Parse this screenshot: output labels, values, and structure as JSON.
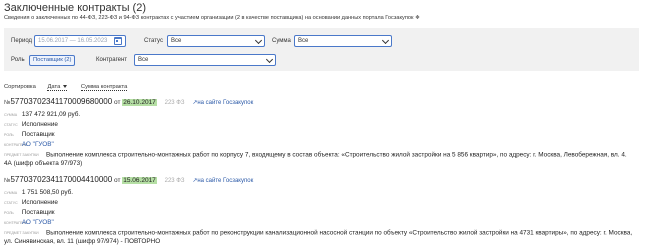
{
  "page": {
    "title": "Заключенные контракты (2)",
    "subtitle": "Сведения о заключенных по 44-ФЗ, 223-ФЗ и 94-ФЗ контрактах с участием организации (2 в качестве поставщика) на основании данных портала Госзакупок",
    "info_icon": "info-icon"
  },
  "filters": {
    "period_label": "Период",
    "period_placeholder": "15.06.2017 — 16.05.2023",
    "status_label": "Статус",
    "status_value": "Все",
    "sum_label": "Сумма",
    "sum_value": "Все",
    "role_label": "Роль",
    "role_value": "Поставщик (2)",
    "counterparty_label": "Контрагент",
    "counterparty_value": "Все"
  },
  "sort": {
    "label": "Сортировка",
    "selected": "Дата",
    "alt": "Сумма контракта"
  },
  "labels": {
    "sum": "сумма",
    "status": "статус",
    "role": "роль",
    "customer": "контрагент",
    "subject": "предмет закупки",
    "from": "от",
    "no": "№",
    "link": "на сайте Госзакупок"
  },
  "contracts": [
    {
      "number": "57703702341170009680000",
      "date": "26.10.2017",
      "law": "223 ФЗ",
      "sum": "137 472 921,09 руб.",
      "status": "Исполнение",
      "role": "Поставщик",
      "customer": "АО \"ГУОВ\"",
      "subject": "Выполнение комплекса строительно-монтажных работ по корпусу 7, входящему в состав объекта: «Строительство жилой застройки на 5 856 квартир», по адресу: г. Москва, Левобережная, вл. 4. 4А (шифр объекта 97/973)"
    },
    {
      "number": "57703702341170004410000",
      "date": "15.06.2017",
      "law": "223 ФЗ",
      "sum": "1 751 508,50 руб.",
      "status": "Исполнение",
      "role": "Поставщик",
      "customer": "АО \"ГУОВ\"",
      "subject": "Выполнение комплекса строительно-монтажных работ по реконструкции канализационной насосной станции по объекту «Строительство жилой застройки на 4731 квартиры», по адресу: г. Москва, ул. Синявинская, вл. 11 (шифр 97/974) - ПОВТОРНО"
    }
  ]
}
